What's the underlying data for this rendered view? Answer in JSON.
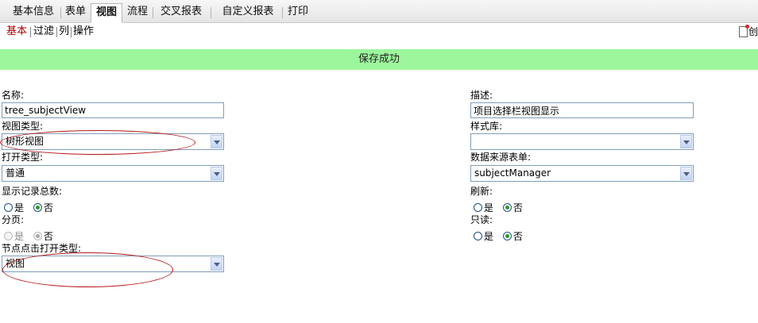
{
  "tabs": [
    {
      "label": "基本信息",
      "active": false
    },
    {
      "label": "表单",
      "active": false
    },
    {
      "label": "视图",
      "active": true
    },
    {
      "label": "流程",
      "active": false
    },
    {
      "label": "交叉报表",
      "active": false
    },
    {
      "label": "自定义报表",
      "active": false
    },
    {
      "label": "打印",
      "active": false
    }
  ],
  "subtabs": [
    {
      "label": "基本",
      "active": true
    },
    {
      "label": "过滤",
      "active": false
    },
    {
      "label": "列",
      "active": false
    },
    {
      "label": "操作",
      "active": false
    }
  ],
  "toolbar": {
    "create_label": "创",
    "create_icon": "new-document-icon"
  },
  "banner": {
    "message": "保存成功",
    "color": "#9cf79c"
  },
  "form": {
    "name": {
      "label": "名称:",
      "value": "tree_subjectView"
    },
    "description": {
      "label": "描述:",
      "value": "项目选择栏视图显示"
    },
    "view_type": {
      "label": "视图类型:",
      "value": "树形视图"
    },
    "style_lib": {
      "label": "样式库:",
      "value": ""
    },
    "open_type": {
      "label": "打开类型:",
      "value": "普通"
    },
    "data_source": {
      "label": "数据来源表单:",
      "value": "subjectManager"
    },
    "show_total": {
      "label": "显示记录总数:",
      "options": [
        "是",
        "否"
      ],
      "selected": "否"
    },
    "refresh": {
      "label": "刷新:",
      "options": [
        "是",
        "否"
      ],
      "selected": "否"
    },
    "paging": {
      "label": "分页:",
      "options": [
        "是",
        "否"
      ],
      "selected": "否",
      "disabled": true
    },
    "readonly": {
      "label": "只读:",
      "options": [
        "是",
        "否"
      ],
      "selected": "否"
    },
    "node_open_type": {
      "label": "节点点击打开类型:",
      "value": "视图"
    }
  },
  "colors": {
    "annotation": "#b51818",
    "radio_check": "#2a9a2a",
    "active_subtab": "#b00000"
  }
}
